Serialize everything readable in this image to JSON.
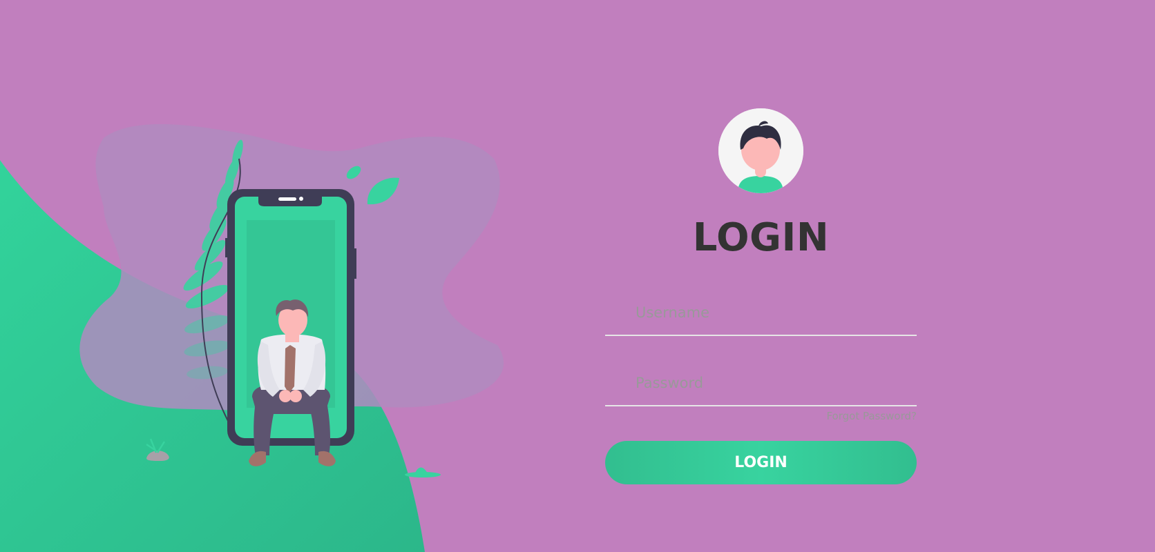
{
  "login": {
    "title": "LOGIN",
    "username": {
      "value": "",
      "placeholder": "Username"
    },
    "password": {
      "value": "",
      "placeholder": "Password"
    },
    "forgot_password": "Forgot Password?",
    "submit_label": "LOGIN"
  },
  "icons": {
    "avatar": "user-avatar-icon",
    "illustration": "phone-person-illustration"
  },
  "colors": {
    "background": "#c17fbe",
    "accent": "#38d39f",
    "accent_dark": "#32be8f",
    "title": "#333333",
    "placeholder": "#999999",
    "phone_frame": "#3f3d56",
    "blob": "#b08bc0"
  }
}
